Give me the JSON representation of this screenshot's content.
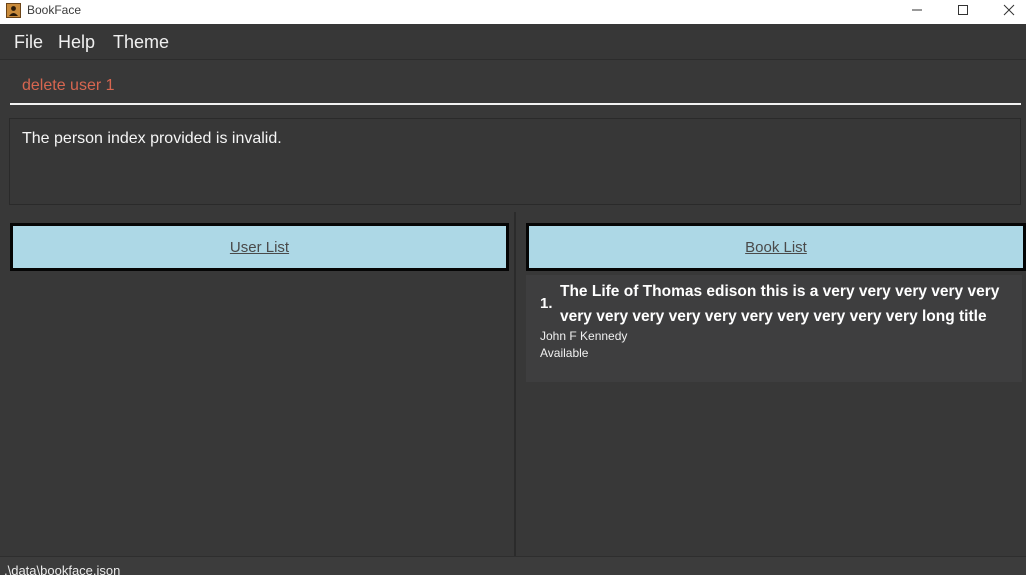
{
  "window": {
    "title": "BookFace",
    "app_icon": "bookface-app-icon",
    "controls": [
      "minimize-icon",
      "maximize-icon",
      "close-icon"
    ]
  },
  "menu": {
    "items": [
      {
        "label": "File"
      },
      {
        "label": "Help"
      },
      {
        "label": "Theme"
      }
    ]
  },
  "command": {
    "value": "delete user 1",
    "text_color": "#d76650"
  },
  "result": {
    "message": "The person index provided is invalid."
  },
  "user_list": {
    "header": "User List",
    "items": []
  },
  "book_list": {
    "header": "Book List",
    "items": [
      {
        "index": "1.",
        "title": "The Life of Thomas edison  this is a very very very very very very very very very very very very very very very long title",
        "author": "John F Kennedy",
        "status": "Available"
      }
    ]
  },
  "status_bar": {
    "path": ".\\data\\bookface.json"
  },
  "colors": {
    "background": "#383838",
    "header_fill": "#add8e6",
    "header_border": "#050505"
  }
}
